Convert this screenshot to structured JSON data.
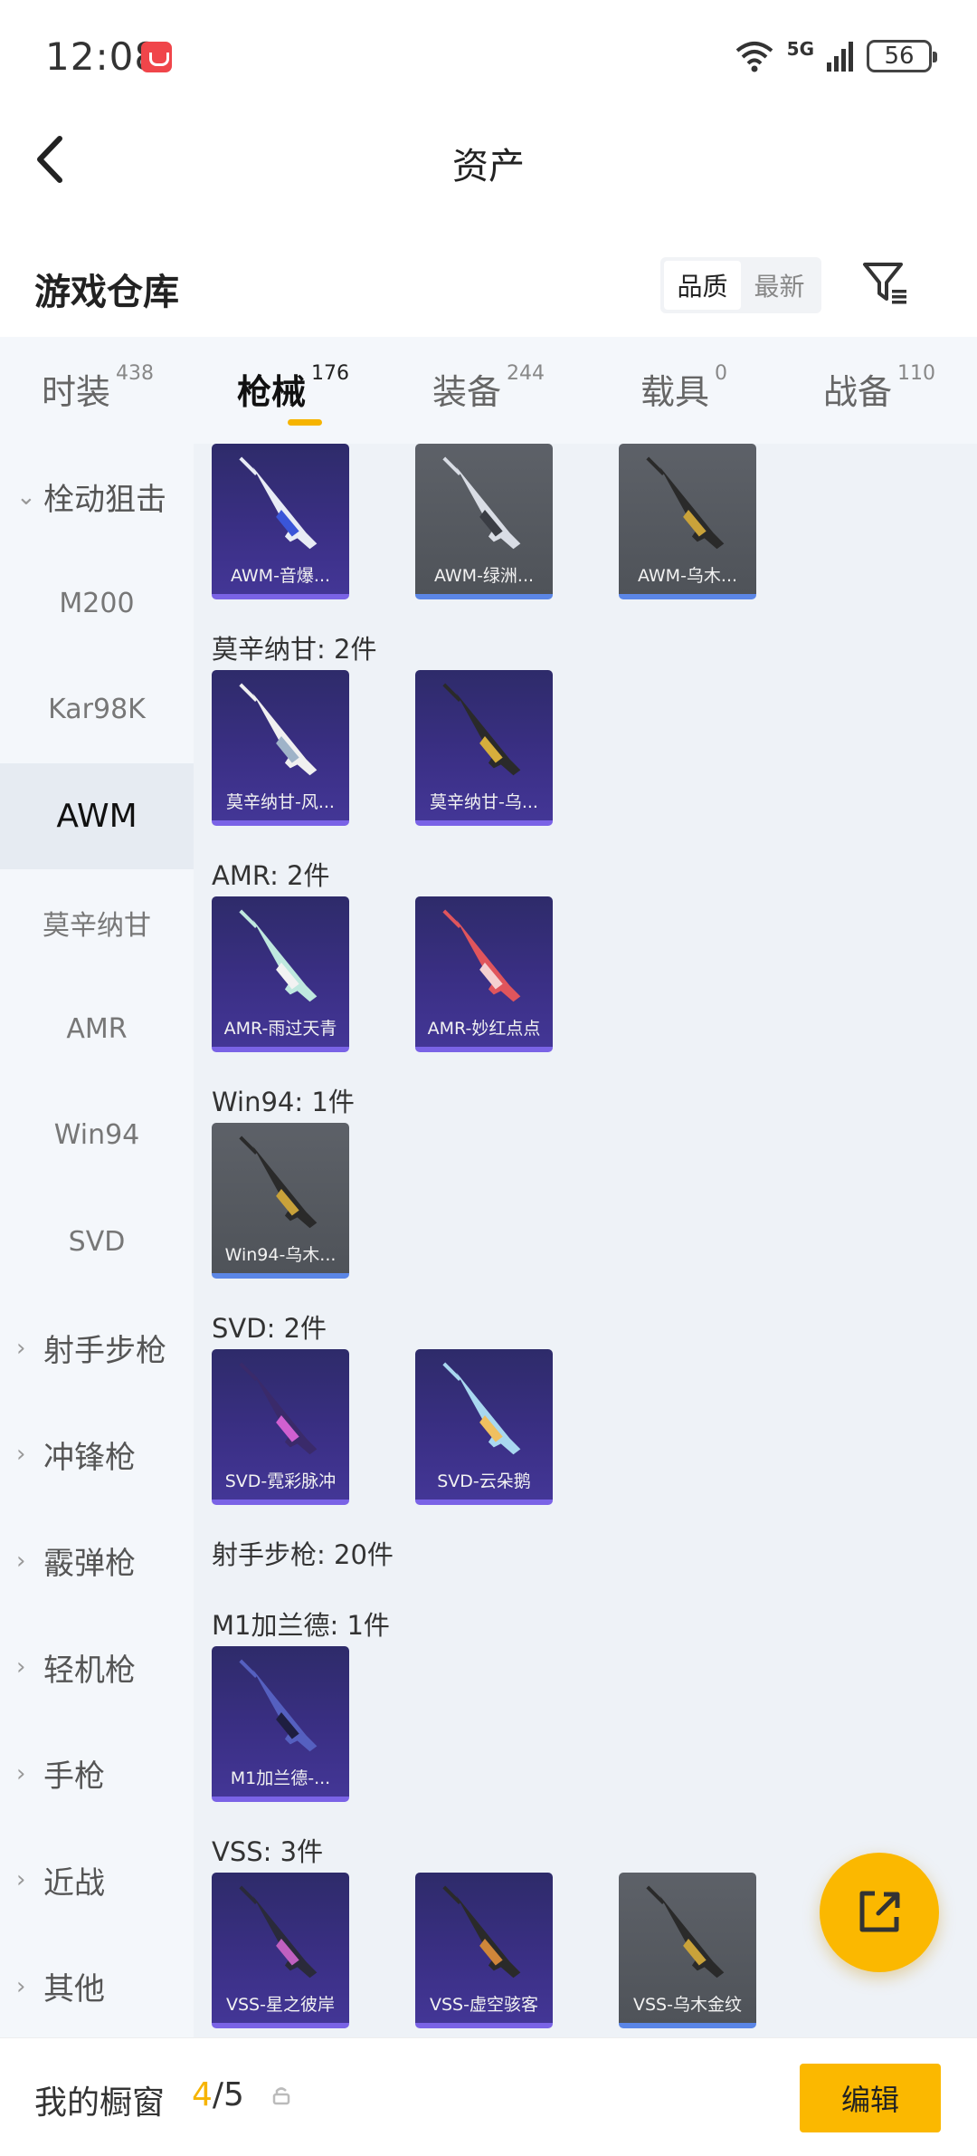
{
  "status": {
    "time": "12:08",
    "network": "5G",
    "battery": "56"
  },
  "header": {
    "title": "资产"
  },
  "warehouse": {
    "title": "游戏仓库",
    "sort_options": [
      "品质",
      "最新"
    ],
    "sort_active": "品质"
  },
  "tabs": [
    {
      "label": "时装",
      "count": "438",
      "active": false
    },
    {
      "label": "枪械",
      "count": "176",
      "active": true
    },
    {
      "label": "装备",
      "count": "244",
      "active": false
    },
    {
      "label": "载具",
      "count": "0",
      "active": false
    },
    {
      "label": "战备",
      "count": "110",
      "active": false
    }
  ],
  "sidebar": {
    "items": [
      {
        "label": "栓动狙击",
        "type": "group",
        "expanded": true
      },
      {
        "label": "M200",
        "type": "sub"
      },
      {
        "label": "Kar98K",
        "type": "sub"
      },
      {
        "label": "AWM",
        "type": "sub",
        "active": true
      },
      {
        "label": "莫辛纳甘",
        "type": "sub"
      },
      {
        "label": "AMR",
        "type": "sub"
      },
      {
        "label": "Win94",
        "type": "sub"
      },
      {
        "label": "SVD",
        "type": "sub"
      },
      {
        "label": "射手步枪",
        "type": "group"
      },
      {
        "label": "冲锋枪",
        "type": "group"
      },
      {
        "label": "霰弹枪",
        "type": "group"
      },
      {
        "label": "轻机枪",
        "type": "group"
      },
      {
        "label": "手枪",
        "type": "group"
      },
      {
        "label": "近战",
        "type": "group"
      },
      {
        "label": "其他",
        "type": "group"
      }
    ]
  },
  "sections": [
    {
      "title": "",
      "cards": [
        {
          "name": "AWM-音爆...",
          "style": "purple",
          "colors": [
            "#e8ecf5",
            "#3a55d8"
          ]
        },
        {
          "name": "AWM-绿洲...",
          "style": "gray",
          "colors": [
            "#d9dde5",
            "#3a3d44"
          ]
        },
        {
          "name": "AWM-乌木...",
          "style": "gray",
          "colors": [
            "#2a2a2a",
            "#c9a23a"
          ]
        }
      ]
    },
    {
      "title": "莫辛纳甘: 2件",
      "cards": [
        {
          "name": "莫辛纳甘-风...",
          "style": "purple",
          "colors": [
            "#f0f0f0",
            "#9fb3c8"
          ]
        },
        {
          "name": "莫辛纳甘-乌...",
          "style": "purple",
          "colors": [
            "#2a2a2a",
            "#d6ae3c"
          ]
        }
      ]
    },
    {
      "title": "AMR: 2件",
      "cards": [
        {
          "name": "AMR-雨过天青",
          "style": "purple",
          "colors": [
            "#bfe8df",
            "#f2f2f2"
          ]
        },
        {
          "name": "AMR-妙红点点",
          "style": "purple",
          "colors": [
            "#e0555c",
            "#f5d0d0"
          ]
        }
      ]
    },
    {
      "title": "Win94: 1件",
      "cards": [
        {
          "name": "Win94-乌木...",
          "style": "gray",
          "colors": [
            "#2a2a2a",
            "#c9a23a"
          ]
        }
      ]
    },
    {
      "title": "SVD: 2件",
      "cards": [
        {
          "name": "SVD-霓彩脉冲",
          "style": "purple",
          "colors": [
            "#3a2a6a",
            "#d060d0"
          ]
        },
        {
          "name": "SVD-云朵鹅",
          "style": "purple",
          "colors": [
            "#a9d8f0",
            "#f0c060"
          ]
        }
      ]
    },
    {
      "title": "射手步枪: 20件",
      "cards": []
    },
    {
      "title": "M1加兰德: 1件",
      "cards": [
        {
          "name": "M1加兰德-...",
          "style": "purple",
          "colors": [
            "#5560c0",
            "#1e1e40"
          ]
        }
      ]
    },
    {
      "title": "VSS: 3件",
      "cards": [
        {
          "name": "VSS-星之彼岸",
          "style": "purple",
          "colors": [
            "#2a2a3a",
            "#c060c0"
          ]
        },
        {
          "name": "VSS-虚空骇客",
          "style": "purple",
          "colors": [
            "#2a2a2a",
            "#d0863a"
          ]
        },
        {
          "name": "VSS-乌木金纹",
          "style": "gray",
          "colors": [
            "#2a2a2a",
            "#c9a23a"
          ]
        }
      ]
    }
  ],
  "bottom": {
    "label": "我的橱窗",
    "current": "4",
    "total": "5",
    "edit": "编辑"
  }
}
